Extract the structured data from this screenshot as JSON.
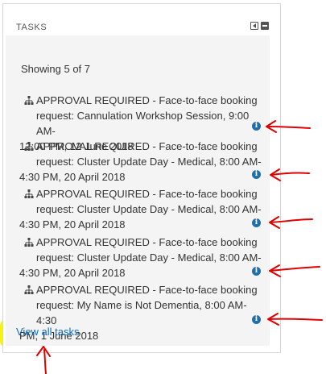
{
  "block": {
    "title": "TASKS",
    "controls": [
      {
        "icon": "dock-icon"
      },
      {
        "icon": "collapse-icon"
      }
    ]
  },
  "summary": "Showing 5 of 7",
  "tasks": [
    {
      "line1": "APPROVAL REQUIRED - Face-to-face booking",
      "line2": "request: Cannulation Workshop Session, 9:00 AM-",
      "line3": "12:00 PM, 12 June 2018"
    },
    {
      "line1": "APPROVAL REQUIRED - Face-to-face booking",
      "line2": "request: Cluster Update Day - Medical, 8:00 AM-",
      "line3": "4:30 PM, 20 April 2018"
    },
    {
      "line1": "APPROVAL REQUIRED - Face-to-face booking",
      "line2": "request: Cluster Update Day - Medical, 8:00 AM-",
      "line3": "4:30 PM, 20 April 2018"
    },
    {
      "line1": "APPROVAL REQUIRED - Face-to-face booking",
      "line2": "request: Cluster Update Day - Medical, 8:00 AM-",
      "line3": "4:30 PM, 20 April 2018"
    },
    {
      "line1": "APPROVAL REQUIRED - Face-to-face booking",
      "line2": "request: My Name is Not Dementia, 8:00 AM-4:30",
      "line3": "PM, 1 June 2018"
    }
  ],
  "info_icon_glyph": "i",
  "view_all_label": "View all tasks",
  "colors": {
    "link": "#0f6cbf",
    "info_icon": "#1f6fa9",
    "annotation_arrow": "#e00000",
    "highlight": "#f5f214"
  }
}
